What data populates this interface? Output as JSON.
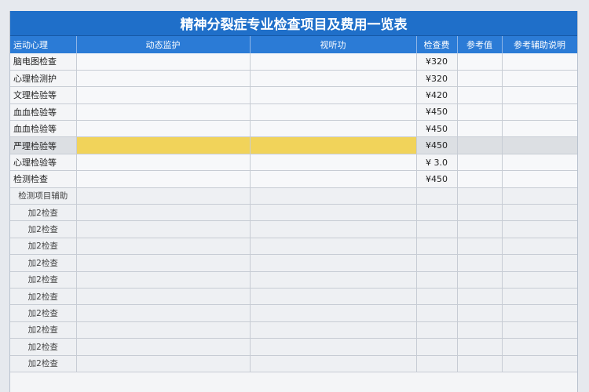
{
  "title": "精神分裂症专业检查项目及费用一览表",
  "colors": {
    "title_bg": "#1f6fc9",
    "header_bg": "#2b7bd6",
    "highlight": "#f1d35a"
  },
  "columns": [
    "运动心理",
    "动态监护",
    "视听功",
    "检查费",
    "参考值",
    "参考辅助说明"
  ],
  "rows": [
    {
      "name": "脑电图检查",
      "price": "¥320"
    },
    {
      "name": "心理检测护",
      "price": "¥320"
    },
    {
      "name": "文理检验等",
      "price": "¥420"
    },
    {
      "name": "血血检验等",
      "price": "¥450"
    },
    {
      "name": "血血检验等",
      "price": "¥450"
    },
    {
      "name": "严理检验等",
      "price": "¥450"
    },
    {
      "name": "心理检验等",
      "price": "¥ 3.0"
    },
    {
      "name": "检测检查",
      "price": "¥450"
    },
    {
      "name": "检测项目辅助",
      "price": ""
    },
    {
      "name": "加2检查",
      "price": ""
    },
    {
      "name": "加2检查",
      "price": ""
    },
    {
      "name": "加2检查",
      "price": ""
    },
    {
      "name": "加2检查",
      "price": ""
    },
    {
      "name": "加2检查",
      "price": ""
    },
    {
      "name": "加2检查",
      "price": ""
    },
    {
      "name": "加2检查",
      "price": ""
    },
    {
      "name": "加2检查",
      "price": ""
    },
    {
      "name": "加2检查",
      "price": ""
    },
    {
      "name": "加2检查",
      "price": ""
    }
  ]
}
